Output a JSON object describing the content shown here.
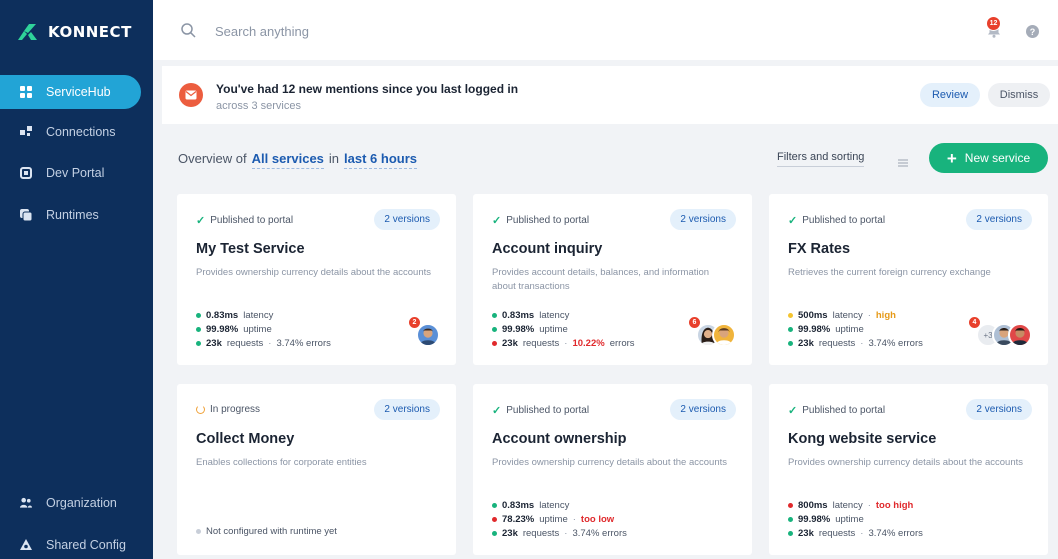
{
  "sidebar": {
    "logo_text": "KONNECT",
    "nav": [
      {
        "label": "ServiceHub",
        "icon": "grid-icon",
        "active": true
      },
      {
        "label": "Connections",
        "icon": "connections-icon"
      },
      {
        "label": "Dev Portal",
        "icon": "portal-icon"
      },
      {
        "label": "Runtimes",
        "icon": "runtimes-icon"
      }
    ],
    "bottom": [
      {
        "label": "Organization",
        "icon": "users-icon"
      },
      {
        "label": "Shared Config",
        "icon": "shared-config-icon"
      }
    ]
  },
  "topbar": {
    "search_placeholder": "Search anything",
    "notification_count": "12"
  },
  "banner": {
    "title": "You've had 12 new mentions since you last logged in",
    "subtitle": "across 3 services",
    "review": "Review",
    "dismiss": "Dismiss"
  },
  "overview": {
    "prefix": "Overview of",
    "scope": "All services",
    "middle": "in",
    "range": "last 6 hours",
    "filters": "Filters and sorting",
    "new_service": "New service"
  },
  "colors": {
    "sidebar_bg": "#0d2f5c",
    "active_nav": "#22a4d6",
    "accent_green": "#18b37d",
    "link_blue": "#1c5bb0",
    "alert_red": "#e0292c"
  },
  "cards": [
    {
      "status": "Published to portal",
      "versions": "2 versions",
      "title": "My Test Service",
      "desc": "Provides ownership currency details about the accounts",
      "metrics": [
        {
          "value": "0.83ms",
          "label": "latency"
        },
        {
          "value": "99.98%",
          "label": "uptime"
        },
        {
          "value": "23k",
          "label": "requests",
          "extra_sep": "·",
          "extra": "3.74% errors"
        }
      ],
      "avatar_badge": "2"
    },
    {
      "status": "Published to portal",
      "versions": "2 versions",
      "title": "Account inquiry",
      "desc": "Provides account details, balances, and information about transactions",
      "metrics": [
        {
          "value": "0.83ms",
          "label": "latency"
        },
        {
          "value": "99.98%",
          "label": "uptime"
        },
        {
          "value": "23k",
          "label": "requests",
          "extra_sep": "·",
          "extra_bad": "10.22%",
          "extra": "errors"
        }
      ],
      "avatar_badge": "6"
    },
    {
      "status": "Published to portal",
      "versions": "2 versions",
      "title": "FX Rates",
      "desc": "Retrieves the current foreign currency exchange",
      "metrics": [
        {
          "value": "500ms",
          "label": "latency",
          "extra_sep": "·",
          "flag": "high"
        },
        {
          "value": "99.98%",
          "label": "uptime"
        },
        {
          "value": "23k",
          "label": "requests",
          "extra_sep": "·",
          "extra": "3.74% errors"
        }
      ],
      "avatar_badge": "4",
      "avatar_more": "+3"
    },
    {
      "status": "In progress",
      "versions": "2 versions",
      "title": "Collect Money",
      "desc": "Enables collections for corporate entities",
      "not_configured": "Not configured with runtime yet"
    },
    {
      "status": "Published to portal",
      "versions": "2 versions",
      "title": "Account ownership",
      "desc": "Provides ownership currency details about the accounts",
      "metrics": [
        {
          "value": "0.83ms",
          "label": "latency"
        },
        {
          "value": "78.23%",
          "label": "uptime",
          "extra_sep": "·",
          "flag": "too low"
        },
        {
          "value": "23k",
          "label": "requests",
          "extra_sep": "·",
          "extra": "3.74% errors"
        }
      ]
    },
    {
      "status": "Published to portal",
      "versions": "2 versions",
      "title": "Kong website service",
      "desc": "Provides ownership currency details about the accounts",
      "metrics": [
        {
          "value": "800ms",
          "label": "latency",
          "extra_sep": "·",
          "flag": "too high"
        },
        {
          "value": "99.98%",
          "label": "uptime"
        },
        {
          "value": "23k",
          "label": "requests",
          "extra_sep": "·",
          "extra": "3.74% errors"
        }
      ]
    }
  ]
}
